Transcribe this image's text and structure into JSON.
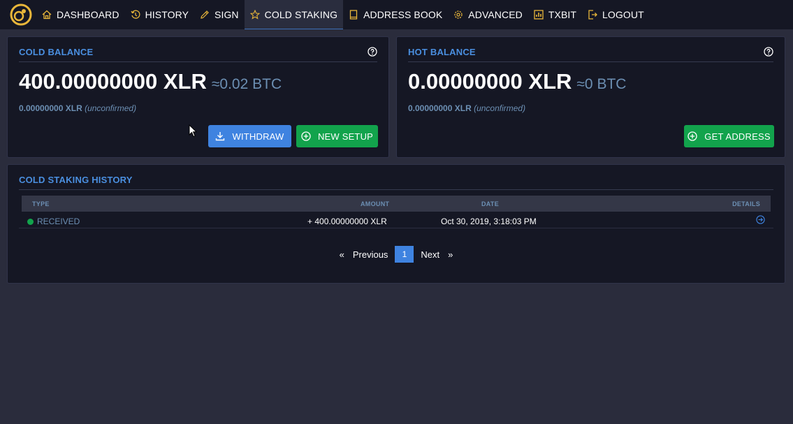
{
  "nav": {
    "items": [
      {
        "label": "DASHBOARD",
        "icon": "home-icon"
      },
      {
        "label": "HISTORY",
        "icon": "history-icon"
      },
      {
        "label": "SIGN",
        "icon": "pencil-icon"
      },
      {
        "label": "COLD STAKING",
        "icon": "star-icon",
        "active": true
      },
      {
        "label": "ADDRESS BOOK",
        "icon": "book-icon"
      },
      {
        "label": "ADVANCED",
        "icon": "gear-icon"
      },
      {
        "label": "TXBIT",
        "icon": "chart-icon"
      },
      {
        "label": "LOGOUT",
        "icon": "logout-icon"
      }
    ]
  },
  "cold_balance": {
    "title": "COLD BALANCE",
    "amount": "400.00000000 XLR",
    "btc": "≈0.02 BTC",
    "unconfirmed_amount": "0.00000000 XLR",
    "unconfirmed_label": "(unconfirmed)",
    "withdraw_label": "WITHDRAW",
    "new_setup_label": "NEW SETUP"
  },
  "hot_balance": {
    "title": "HOT BALANCE",
    "amount": "0.00000000 XLR",
    "btc": "≈0 BTC",
    "unconfirmed_amount": "0.00000000 XLR",
    "unconfirmed_label": "(unconfirmed)",
    "get_address_label": "GET ADDRESS"
  },
  "history": {
    "title": "COLD STAKING HISTORY",
    "columns": {
      "type": "TYPE",
      "amount": "AMOUNT",
      "date": "DATE",
      "details": "DETAILS"
    },
    "rows": [
      {
        "type": "RECEIVED",
        "amount": "+ 400.00000000 XLR",
        "date": "Oct 30, 2019, 3:18:03 PM"
      }
    ],
    "pagination": {
      "first": "«",
      "previous": "Previous",
      "current": "1",
      "next": "Next",
      "last": "»"
    }
  },
  "colors": {
    "background": "#2a2c3c",
    "navbar": "#151724",
    "card": "#151724",
    "accent_blue": "#3f83e0",
    "accent_green": "#12a34c",
    "nav_icon_gold": "#e8b63a",
    "muted_text": "#6c8fb3"
  }
}
